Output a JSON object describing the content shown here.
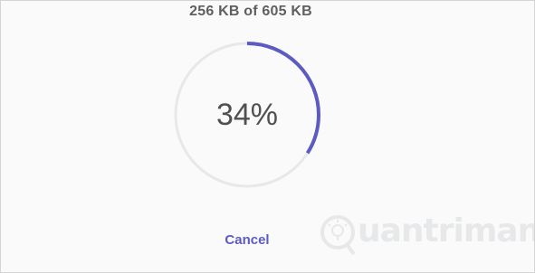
{
  "download": {
    "size_text": "256 KB of 605 KB",
    "percent_text": "34%",
    "progress": 0.34
  },
  "actions": {
    "cancel_label": "Cancel"
  },
  "watermark": {
    "text": "uantrimang",
    "icon": "bulb-q-logo-icon"
  },
  "colors": {
    "accent": "#5b5bc2",
    "track": "#e8e8e8",
    "text": "#505050"
  }
}
